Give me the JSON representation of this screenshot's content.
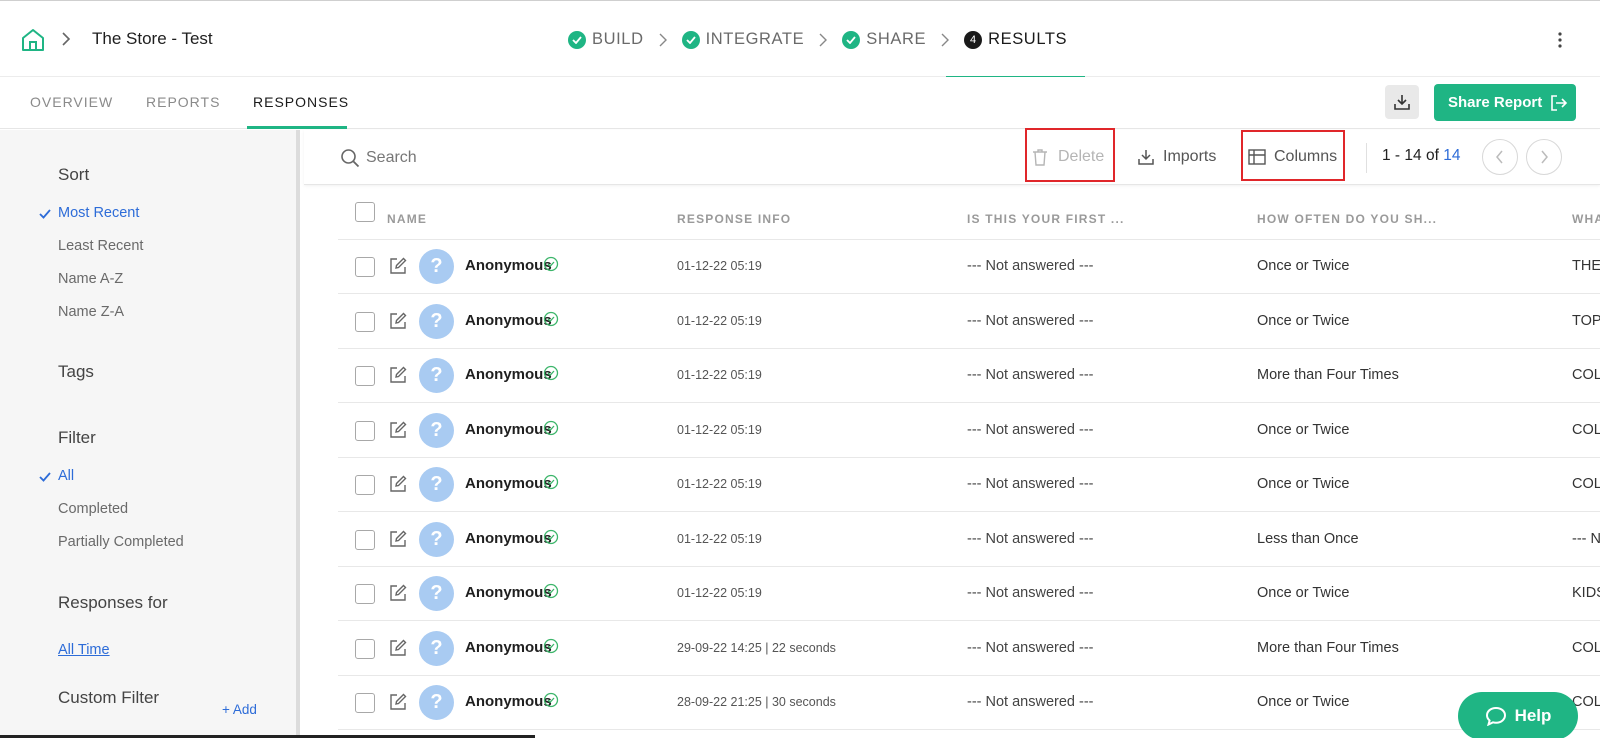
{
  "header": {
    "store_title": "The Store - Test",
    "steps": [
      {
        "label": "BUILD",
        "state": "done"
      },
      {
        "label": "INTEGRATE",
        "state": "done"
      },
      {
        "label": "SHARE",
        "state": "done"
      },
      {
        "label": "RESULTS",
        "state": "active",
        "number": "4"
      }
    ]
  },
  "subnav": {
    "tabs": [
      "OVERVIEW",
      "REPORTS",
      "RESPONSES"
    ],
    "active_tab": "RESPONSES",
    "share_label": "Share Report"
  },
  "sidebar": {
    "sort_heading": "Sort",
    "sort_options": [
      "Most Recent",
      "Least Recent",
      "Name A-Z",
      "Name Z-A"
    ],
    "sort_selected": "Most Recent",
    "tags_heading": "Tags",
    "filter_heading": "Filter",
    "filter_options": [
      "All",
      "Completed",
      "Partially Completed"
    ],
    "filter_selected": "All",
    "responses_for_heading": "Responses for",
    "responses_for_value": "All Time",
    "custom_filter_heading": "Custom Filter",
    "add_label": "+ Add"
  },
  "toolbar": {
    "search_placeholder": "Search",
    "delete_label": "Delete",
    "imports_label": "Imports",
    "columns_label": "Columns",
    "pager_range": "1 - 14",
    "pager_of": "of",
    "pager_total": "14"
  },
  "table": {
    "columns": [
      "NAME",
      "RESPONSE INFO",
      "IS THIS YOUR FIRST ...",
      "HOW OFTEN DO YOU SH...",
      "WHA"
    ],
    "rows": [
      {
        "name": "Anonymous",
        "info": "01-12-22 05:19",
        "first": "--- Not answered ---",
        "how_often": "Once or Twice",
        "what": "THER"
      },
      {
        "name": "Anonymous",
        "info": "01-12-22 05:19",
        "first": "--- Not answered ---",
        "how_often": "Once or Twice",
        "what": "TOPW"
      },
      {
        "name": "Anonymous",
        "info": "01-12-22 05:19",
        "first": "--- Not answered ---",
        "how_often": "More than Four Times",
        "what": "COLL"
      },
      {
        "name": "Anonymous",
        "info": "01-12-22 05:19",
        "first": "--- Not answered ---",
        "how_often": "Once or Twice",
        "what": "COLL"
      },
      {
        "name": "Anonymous",
        "info": "01-12-22 05:19",
        "first": "--- Not answered ---",
        "how_often": "Once or Twice",
        "what": "COLL"
      },
      {
        "name": "Anonymous",
        "info": "01-12-22 05:19",
        "first": "--- Not answered ---",
        "how_often": "Less than Once",
        "what": "--- No"
      },
      {
        "name": "Anonymous",
        "info": "01-12-22 05:19",
        "first": "--- Not answered ---",
        "how_often": "Once or Twice",
        "what": "KIDS"
      },
      {
        "name": "Anonymous",
        "info": "29-09-22 14:25 | 22 seconds",
        "first": "--- Not answered ---",
        "how_often": "More than Four Times",
        "what": "COLL"
      },
      {
        "name": "Anonymous",
        "info": "28-09-22 21:25 | 30 seconds",
        "first": "--- Not answered ---",
        "how_often": "Once or Twice",
        "what": "COLL"
      }
    ]
  },
  "help_label": "Help",
  "colors": {
    "accent": "#1fb584",
    "link": "#2d6cd8",
    "highlight_box": "#e0262a"
  }
}
